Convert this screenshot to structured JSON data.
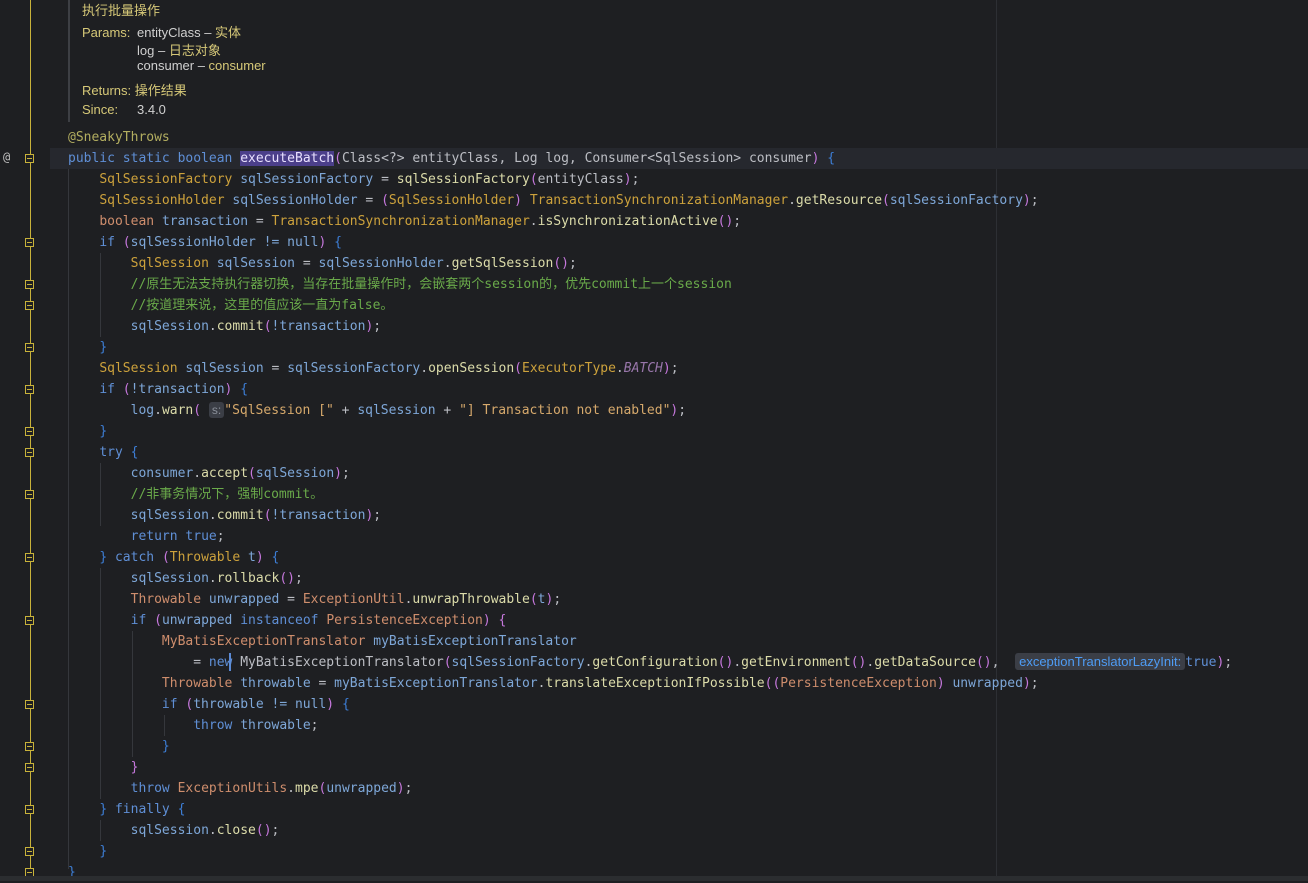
{
  "doc": {
    "summary": "执行批量操作",
    "params_label": "Params:",
    "params": [
      {
        "name": "entityClass",
        "dash": " – ",
        "desc": "实体"
      },
      {
        "name": "log",
        "dash": " – ",
        "desc": "日志对象"
      },
      {
        "name": "consumer",
        "dash": " – ",
        "desc": "consumer"
      }
    ],
    "returns_label": "Returns:",
    "returns_desc": "操作结果",
    "since_label": "Since:",
    "since_value": "3.4.0"
  },
  "gutter": {
    "override_marker": "@"
  },
  "code": {
    "annotation": "@SneakyThrows",
    "sig_mods": "public static boolean",
    "method_name": "executeBatch",
    "sig_params": "Class<?> entityClass, Log log, Consumer<SqlSession> consumer",
    "l1_type": "SqlSessionFactory",
    "l1_var": "sqlSessionFactory",
    "l1_call": "sqlSessionFactory",
    "l1_arg": "entityClass",
    "l2_type": "SqlSessionHolder",
    "l2_var": "sqlSessionHolder",
    "l2_cast": "SqlSessionHolder",
    "l2_cls": "TransactionSynchronizationManager",
    "l2_method": "getResource",
    "l2_arg": "sqlSessionFactory",
    "l3_type": "boolean",
    "l3_var": "transaction",
    "l3_cls": "TransactionSynchronizationManager",
    "l3_method": "isSynchronizationActive",
    "if1_cond": "sqlSessionHolder != null",
    "l4_type": "SqlSession",
    "l4_var": "sqlSession",
    "l4_src": "sqlSessionHolder",
    "l4_method": "getSqlSession",
    "comment1": "//原生无法支持执行器切换，当存在批量操作时，会嵌套两个session的，优先commit上一个session",
    "comment2": "//按道理来说，这里的值应该一直为false。",
    "commit_obj": "sqlSession",
    "commit_method": "commit",
    "commit_arg": "!transaction",
    "l5_type": "SqlSession",
    "l5_var": "sqlSession",
    "l5_src": "sqlSessionFactory",
    "l5_method": "openSession",
    "l5_cls": "ExecutorType",
    "l5_const": "BATCH",
    "if2_cond": "!transaction",
    "warn_obj": "log",
    "warn_method": "warn",
    "warn_hint": "s:",
    "warn_str1": "\"SqlSession [\"",
    "warn_var": "sqlSession",
    "warn_str2": "\"] Transaction not enabled\"",
    "kw_try": "try",
    "accept_obj": "consumer",
    "accept_method": "accept",
    "accept_arg": "sqlSession",
    "comment3": "//非事务情况下，强制commit。",
    "ret_kw": "return",
    "ret_val": "true",
    "kw_catch": "catch",
    "catch_type": "Throwable",
    "catch_var": "t",
    "rollback_method": "rollback",
    "unw_type": "Throwable",
    "unw_var": "unwrapped",
    "unw_cls": "ExceptionUtil",
    "unw_method": "unwrapThrowable",
    "unw_arg": "t",
    "if3_var": "unwrapped",
    "if3_kw": "instanceof",
    "if3_cls": "PersistenceException",
    "mb_type": "MyBatisExceptionTranslator",
    "mb_var": "myBatisExceptionTranslator",
    "mb_new": "new",
    "mb_cls": "MyBatisExceptionTranslator",
    "mb_arg": "sqlSessionFactory",
    "mb_m1": "getConfiguration",
    "mb_m2": "getEnvironment",
    "mb_m3": "getDataSource",
    "mb_hint": "exceptionTranslatorLazyInit:",
    "mb_bool": "true",
    "th_type": "Throwable",
    "th_var": "throwable",
    "th_src": "myBatisExceptionTranslator",
    "th_method": "translateExceptionIfPossible",
    "th_cast": "PersistenceException",
    "th_arg": "unwrapped",
    "if4_cond": "throwable != null",
    "kw_throw": "throw",
    "throw_var": "throwable",
    "mpe_cls": "ExceptionUtils",
    "mpe_method": "mpe",
    "mpe_arg": "unwrapped",
    "kw_finally": "finally",
    "close_method": "close"
  }
}
